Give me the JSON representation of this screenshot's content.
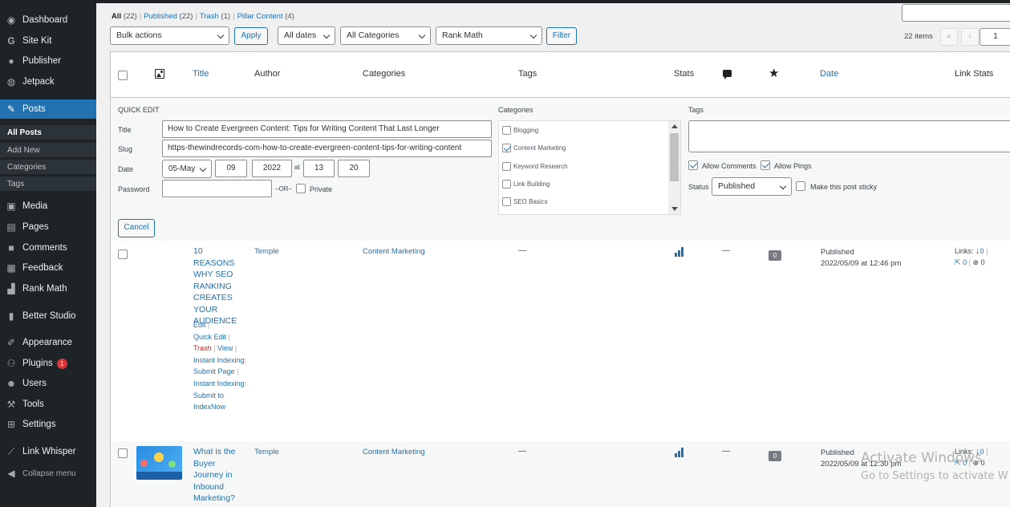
{
  "sidebar": {
    "items": [
      {
        "label": "Dashboard",
        "icon": "dashboard-icon"
      },
      {
        "label": "Site Kit",
        "icon": "sitekit-icon"
      },
      {
        "label": "Publisher",
        "icon": "publisher-icon"
      },
      {
        "label": "Jetpack",
        "icon": "jetpack-icon"
      },
      {
        "label": "Posts",
        "icon": "pin-icon"
      },
      {
        "label": "Media",
        "icon": "media-icon"
      },
      {
        "label": "Pages",
        "icon": "pages-icon"
      },
      {
        "label": "Comments",
        "icon": "comments-icon"
      },
      {
        "label": "Feedback",
        "icon": "feedback-icon"
      },
      {
        "label": "Rank Math",
        "icon": "rankmath-icon"
      },
      {
        "label": "Better Studio",
        "icon": "betterstudio-icon"
      },
      {
        "label": "Appearance",
        "icon": "appearance-icon"
      },
      {
        "label": "Plugins",
        "icon": "plugins-icon",
        "badge": "1"
      },
      {
        "label": "Users",
        "icon": "users-icon"
      },
      {
        "label": "Tools",
        "icon": "tools-icon"
      },
      {
        "label": "Settings",
        "icon": "settings-icon"
      },
      {
        "label": "Link Whisper",
        "icon": "linkwhisper-icon"
      },
      {
        "label": "Collapse menu",
        "icon": "collapse-icon"
      }
    ],
    "submenu": [
      "All Posts",
      "Add New",
      "Categories",
      "Tags"
    ]
  },
  "filters": {
    "all": "All",
    "all_count": "(22)",
    "published": "Published",
    "published_count": "(22)",
    "trash": "Trash",
    "trash_count": "(1)",
    "pillar": "Pillar Content",
    "pillar_count": "(4)"
  },
  "toolbar": {
    "bulk_actions": "Bulk actions",
    "apply": "Apply",
    "all_dates": "All dates",
    "all_categories": "All Categories",
    "rank_math": "Rank Math",
    "filter": "Filter",
    "items": "22 items",
    "first": "«",
    "prev": "‹",
    "page": "1"
  },
  "columns": {
    "title": "Title",
    "author": "Author",
    "categories": "Categories",
    "tags": "Tags",
    "stats": "Stats",
    "date": "Date",
    "link_stats": "Link Stats"
  },
  "quick_edit": {
    "heading": "QUICK EDIT",
    "title_label": "Title",
    "title_value": "How to Create Evergreen Content: Tips for Writing Content That Last Longer",
    "slug_label": "Slug",
    "slug_value": "https-thewindrecords-com-how-to-create-evergreen-content-tips-for-writing-content",
    "date_label": "Date",
    "month": "05-May",
    "day": "09",
    "year": "2022",
    "at": "at",
    "hour": "13",
    "minute": "20",
    "password_label": "Password",
    "or": "–OR–",
    "private": "Private",
    "categories_label": "Categories",
    "categories": [
      {
        "label": "Blogging",
        "checked": false
      },
      {
        "label": "Content Marketing",
        "checked": true
      },
      {
        "label": "Keyword Research",
        "checked": false
      },
      {
        "label": "Link Building",
        "checked": false
      },
      {
        "label": "SEO Basics",
        "checked": false
      }
    ],
    "tags_label": "Tags",
    "allow_comments": "Allow Comments",
    "allow_pings": "Allow Pings",
    "status_label": "Status",
    "status_value": "Published",
    "sticky": "Make this post sticky",
    "cancel": "Cancel"
  },
  "posts": [
    {
      "title": "10 REASONS WHY SEO RANKING CREATES YOUR AUDIENCE",
      "author": "Temple",
      "category": "Content Marketing",
      "tags": "—",
      "comment_dash": "—",
      "comments": "0",
      "status": "Published",
      "date": "2022/05/09 at 12:46 pm",
      "links_label": "Links:",
      "links_in": "0",
      "links_out": "0",
      "links_ext": "0",
      "actions": {
        "edit": "Edit",
        "quick_edit": "Quick Edit",
        "trash": "Trash",
        "view": "View",
        "instant1": "Instant Indexing: Submit Page",
        "instant2": "Instant Indexing: Submit to IndexNow"
      }
    },
    {
      "title": "What is the Buyer Journey in Inbound Marketing?",
      "author": "Temple",
      "category": "Content Marketing",
      "tags": "—",
      "comment_dash": "—",
      "comments": "0",
      "status": "Published",
      "date": "2022/05/09 at 12:30 pm",
      "links_label": "Links:",
      "links_in": "0",
      "links_out": "0",
      "links_ext": "0"
    }
  ],
  "watermark": {
    "line1": "Activate Windows",
    "line2": "Go to Settings to activate W"
  }
}
